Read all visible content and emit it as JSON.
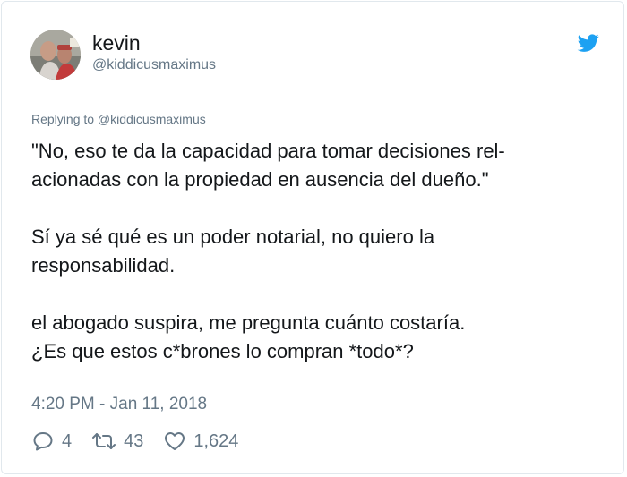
{
  "user": {
    "name": "kevin",
    "handle": "@kiddicusmaximus",
    "avatar_icon": "profile-photo"
  },
  "reply": {
    "replying_to": "Replying to @kiddicusmaximus"
  },
  "tweet": {
    "lines": [
      "\"No, eso te da la capacidad para tomar decisiones rel-",
      "acionadas con la propiedad en ausencia del dueño.\"",
      "Sí ya sé qué es un poder notarial, no quiero la",
      "responsabilidad.",
      "el abogado suspira, me pregunta cuánto costaría.",
      "¿Es que estos c*brones lo compran *todo*?"
    ],
    "timestamp": "4:20 PM - Jan 11, 2018"
  },
  "actions": {
    "replies": "4",
    "retweets": "43",
    "likes": "1,624"
  },
  "colors": {
    "text": "#14171a",
    "secondary": "#657786",
    "twitter_blue": "#1da1f2",
    "border": "#e1e8ed"
  }
}
